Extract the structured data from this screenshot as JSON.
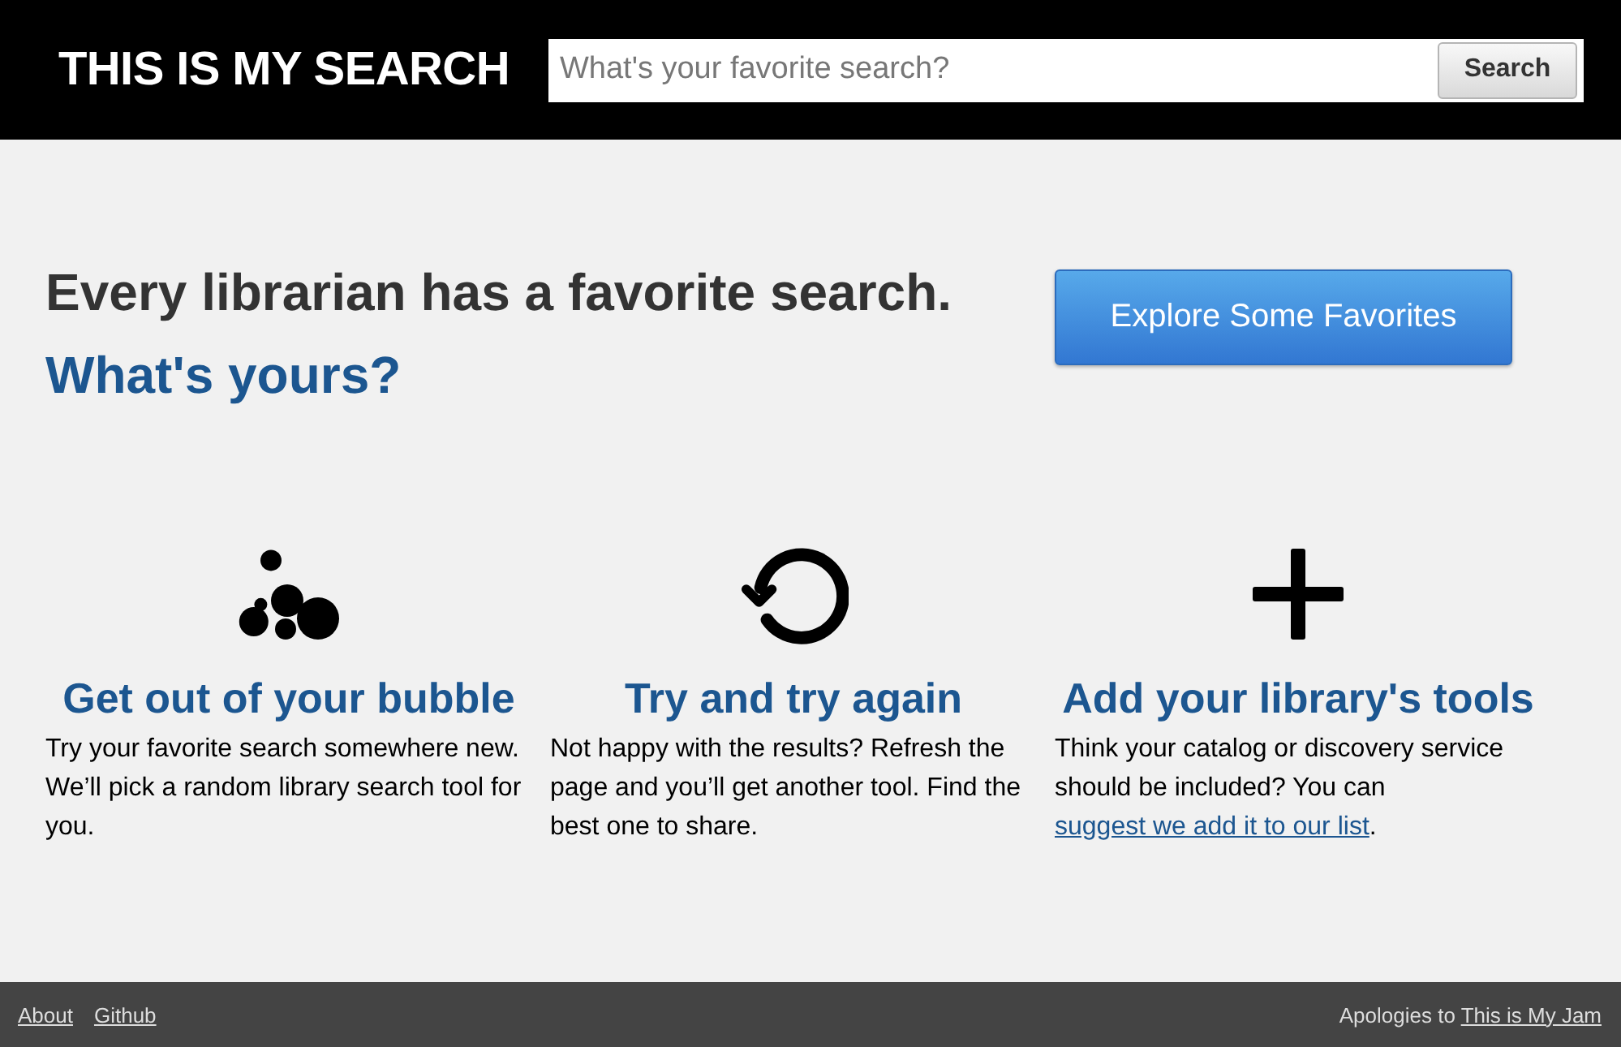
{
  "header": {
    "logo": "THIS IS MY SEARCH",
    "search": {
      "placeholder": "What's your favorite search?",
      "button": "Search"
    }
  },
  "hero": {
    "heading": "Every librarian has a favorite search.",
    "subheading": "What's yours?",
    "button": "Explore Some Favorites"
  },
  "features": [
    {
      "kind": "bubbles",
      "title": "Get out of your bubble",
      "text": [
        {
          "kind": "plain",
          "text": "Try your favorite search somewhere new. We’ll pick a random library search tool for you."
        }
      ]
    },
    {
      "kind": "refresh",
      "title": "Try and try again",
      "text": [
        {
          "kind": "plain",
          "text": "Not happy with the results? Refresh the page and you’ll get another tool. Find the best one to share."
        }
      ]
    },
    {
      "kind": "add",
      "title": "Add your library's tools",
      "text": [
        {
          "kind": "plain",
          "text": "Think your catalog or discovery service should be included? You can "
        },
        {
          "kind": "link",
          "text": "suggest we add it to our list"
        },
        {
          "kind": "plain",
          "text": "."
        }
      ]
    }
  ],
  "footer": {
    "links": [
      "About",
      "Github"
    ],
    "credit": {
      "text": "Apologies to",
      "link": "This is My Jam"
    }
  }
}
